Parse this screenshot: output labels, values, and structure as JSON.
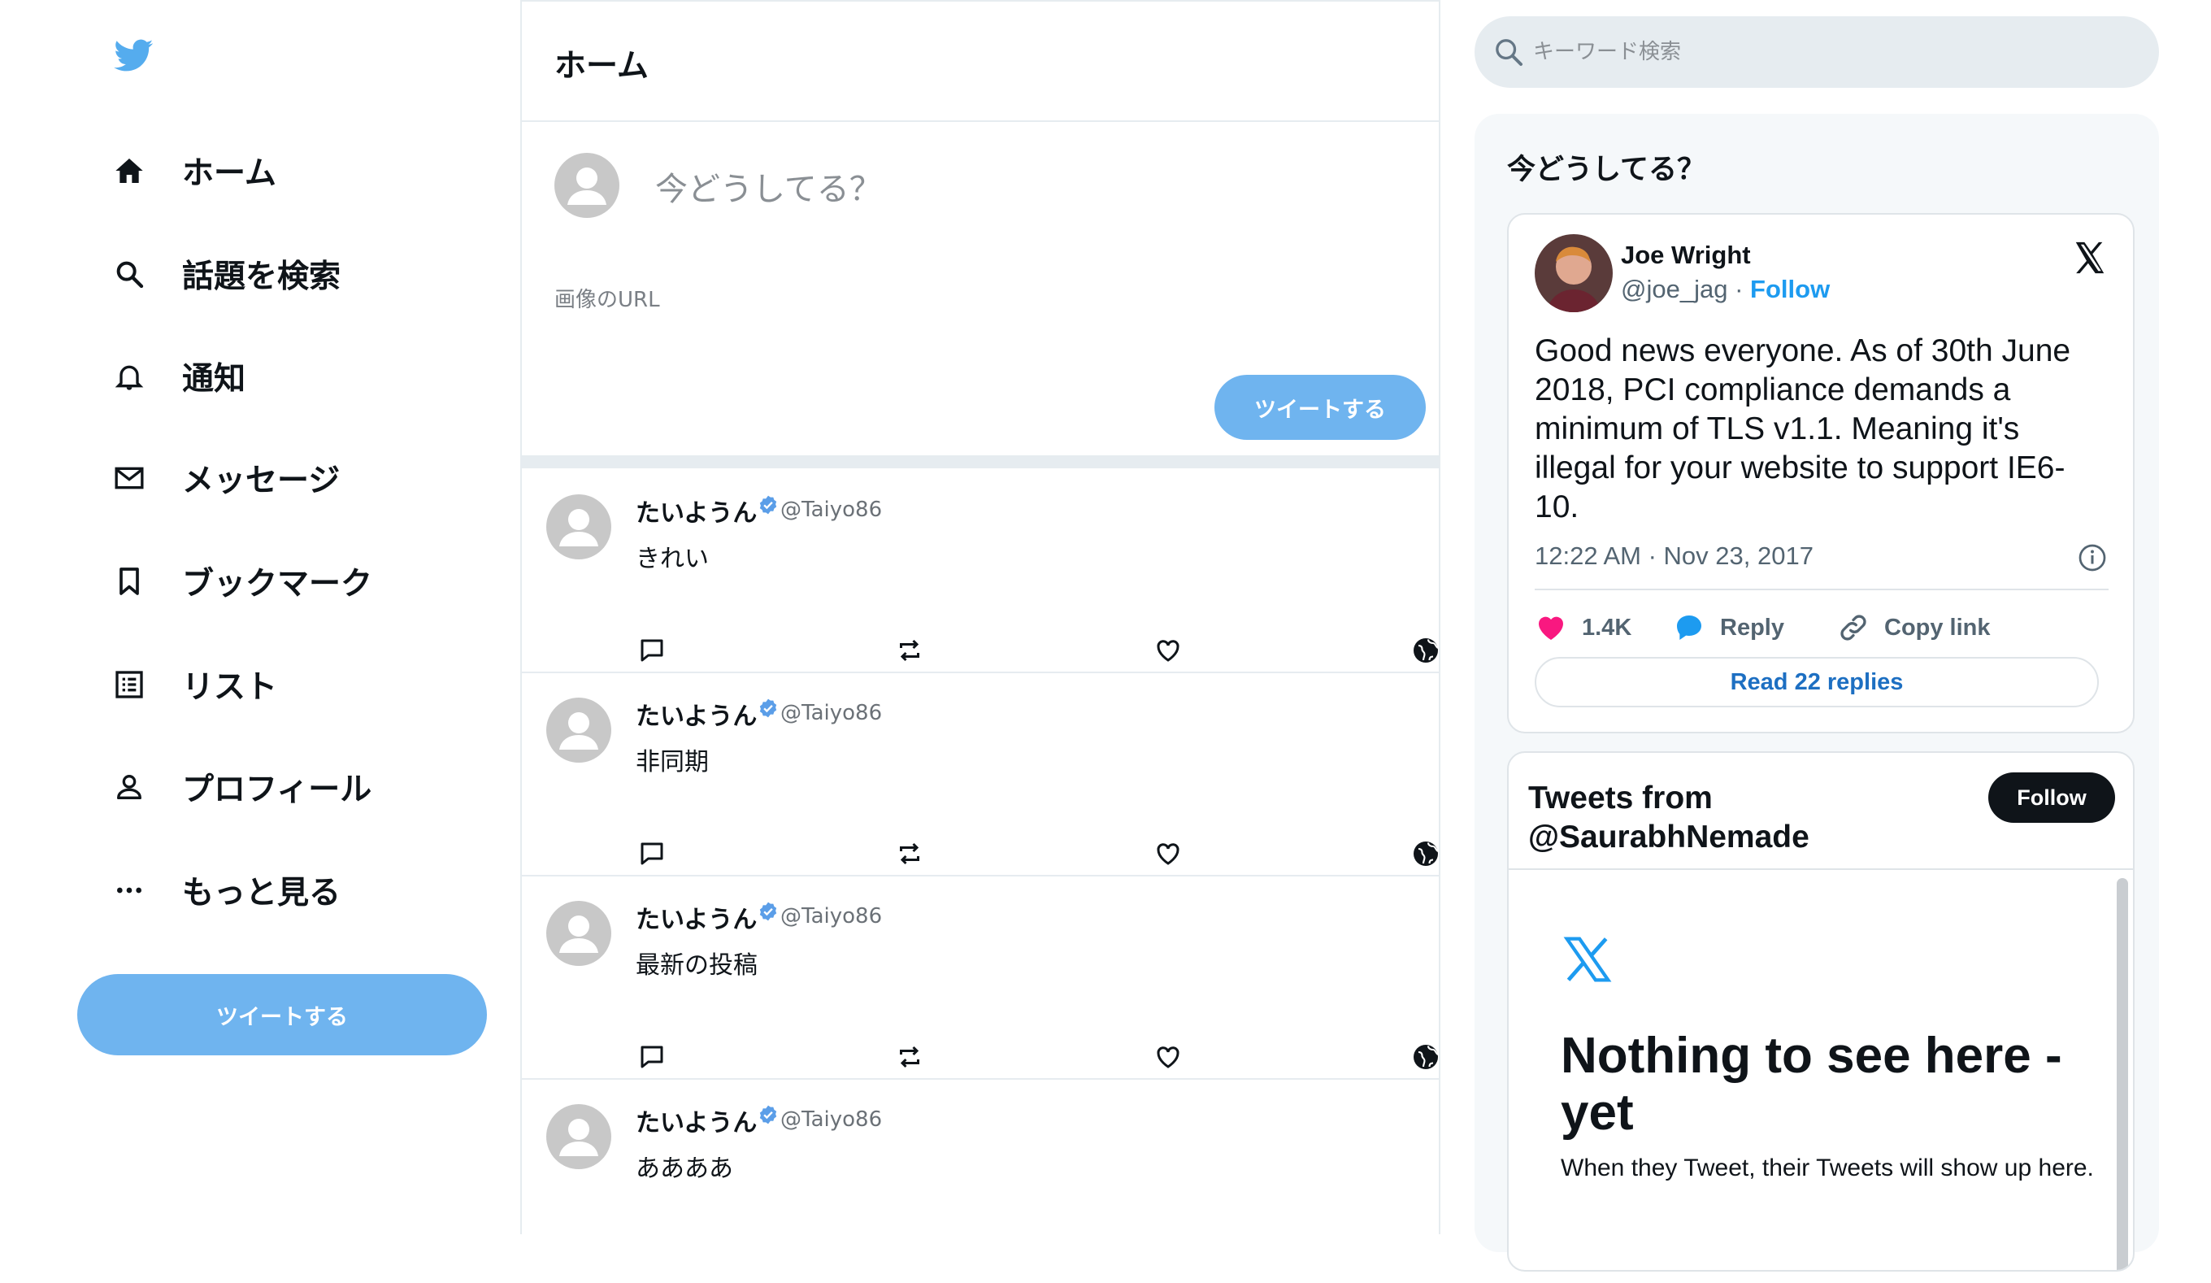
{
  "nav": {
    "items": [
      {
        "label": "ホーム",
        "icon": "home-icon"
      },
      {
        "label": "話題を検索",
        "icon": "search-icon"
      },
      {
        "label": "通知",
        "icon": "bell-icon"
      },
      {
        "label": "メッセージ",
        "icon": "mail-icon"
      },
      {
        "label": "ブックマーク",
        "icon": "bookmark-icon"
      },
      {
        "label": "リスト",
        "icon": "list-icon"
      },
      {
        "label": "プロフィール",
        "icon": "profile-icon"
      },
      {
        "label": "もっと見る",
        "icon": "more-icon"
      }
    ],
    "tweet_button": "ツイートする"
  },
  "header": {
    "title": "ホーム"
  },
  "compose": {
    "placeholder": "今どうしてる？",
    "image_url_label": "画像のURL",
    "submit_label": "ツイートする"
  },
  "feed": [
    {
      "name": "たいようん",
      "handle": "@Taiyo86",
      "text": "きれい"
    },
    {
      "name": "たいようん",
      "handle": "@Taiyo86",
      "text": "非同期"
    },
    {
      "name": "たいようん",
      "handle": "@Taiyo86",
      "text": "最新の投稿"
    },
    {
      "name": "たいようん",
      "handle": "@Taiyo86",
      "text": "ああああ"
    }
  ],
  "search": {
    "placeholder": "キーワード検索"
  },
  "widget": {
    "title": "今どうしてる？",
    "embed": {
      "name": "Joe Wright",
      "handle": "@joe_jag",
      "separator": "·",
      "follow": "Follow",
      "text": "Good news everyone. As of 30th June 2018, PCI compliance demands a minimum of TLS v1.1. Meaning it's illegal for your website to support IE6-10.",
      "time": "12:22 AM · Nov 23, 2017",
      "likes": "1.4K",
      "reply": "Reply",
      "copy_link": "Copy link",
      "read_replies": "Read 22 replies"
    },
    "timeline": {
      "title": "Tweets from @SaurabhNemade",
      "follow": "Follow",
      "empty_title": "Nothing to see here - yet",
      "empty_sub": "When they Tweet, their Tweets will show up here."
    }
  },
  "colors": {
    "accent": "#6fb4ef",
    "link": "#1d9bf0",
    "like": "#f91880",
    "border": "#e6ecf0"
  }
}
